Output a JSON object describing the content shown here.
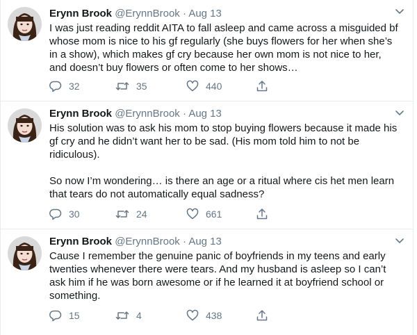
{
  "tweets": [
    {
      "name": "Erynn Brook",
      "handle": "@ErynnBrook",
      "separator": " · ",
      "date": "Aug 13",
      "paragraphs": [
        "I was just reading reddit AITA to fall asleep and came across a misguided bf whose mom is nice to his gf regularly (she buys flowers for her when she’s in a show), which makes gf cry because her own mom is not nice to her, and doesn’t buy flowers or often come to her shows…"
      ],
      "replies": "32",
      "retweets": "35",
      "likes": "440"
    },
    {
      "name": "Erynn Brook",
      "handle": "@ErynnBrook",
      "separator": " · ",
      "date": "Aug 13",
      "paragraphs": [
        "His solution was to ask his mom to stop buying flowers because it made his gf cry and he didn’t want her to be sad. (His mom told him to not be ridiculous).",
        "So now I’m wondering… is there an age or a ritual where cis het men learn that tears do not automatically equal sadness?"
      ],
      "replies": "30",
      "retweets": "24",
      "likes": "661"
    },
    {
      "name": "Erynn Brook",
      "handle": "@ErynnBrook",
      "separator": " · ",
      "date": "Aug 13",
      "paragraphs": [
        "Cause I remember the genuine panic of boyfriends in my teens and early twenties whenever there were tears. And my husband is asleep so I can’t ask him if he was born awesome or if he learned it at boyfriend school or something."
      ],
      "replies": "15",
      "retweets": "4",
      "likes": "438"
    }
  ],
  "icons": {
    "reply": "reply-icon",
    "retweet": "retweet-icon",
    "like": "heart-icon",
    "share": "share-icon",
    "more": "chevron-down-icon"
  },
  "colors": {
    "text": "#14171a",
    "muted": "#657786",
    "divider": "#e6ecf0",
    "background": "#ffffff"
  }
}
